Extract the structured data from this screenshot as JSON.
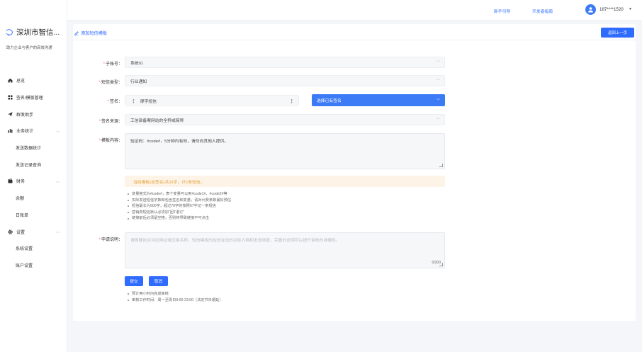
{
  "sidebar": {
    "brand_name": "深圳市智信...",
    "tagline": "助力企业与客户的高效沟通",
    "items": [
      {
        "label": "总览",
        "icon": "home-icon"
      },
      {
        "label": "签名/模板管理",
        "icon": "grid-icon"
      },
      {
        "label": "群发助手",
        "icon": "send-icon"
      },
      {
        "label": "业务统计",
        "icon": "bar-chart-icon",
        "expanded": true
      },
      {
        "label": "发送数据统计",
        "sub": true
      },
      {
        "label": "发送记录查询",
        "sub": true
      },
      {
        "label": "财务",
        "icon": "wallet-icon",
        "expanded": true
      },
      {
        "label": "余额",
        "sub": true
      },
      {
        "label": "日账单",
        "sub": true
      },
      {
        "label": "设置",
        "icon": "gear-icon",
        "expanded": true
      },
      {
        "label": "系统设置",
        "sub": true
      },
      {
        "label": "账户设置",
        "sub": true
      }
    ]
  },
  "header": {
    "guide_link": "新手引导",
    "dev_link": "开发者指南",
    "user_phone": "187****1520"
  },
  "page": {
    "title": "添加短信模板",
    "back_button": "返回上一页"
  },
  "form": {
    "sub_account": {
      "label": "子账号：",
      "value": "系统01"
    },
    "sms_type": {
      "label": "短信类型：",
      "value": "行业通知"
    },
    "signature": {
      "label": "签名：",
      "open_bracket": "【",
      "close_bracket": "】",
      "value": "摩字短信",
      "select_label": "选择已有签名"
    },
    "signature_source": {
      "label": "签名来源：",
      "value": "工信部备案网站的全称或简称"
    },
    "template_content": {
      "label": "模板内容：",
      "value": "验证码：#code#，5分钟内有效，请勿向其他人提供。"
    },
    "count_warning": "当前模板(含签名)共33字，计1条短信。",
    "content_notes": [
      "变量格式为#code#，表个变量可以用#code1#、#code2#等",
      "实际发送短信字数和包含签名和变量，请对计费条数最好预估",
      "短信最长为500字，超过70字的按照67字记一条短信",
      "营销类短信默认必须加“回T退订”",
      "链接前后必须留空格，否则将导致链接不可点击"
    ],
    "apply_desc": {
      "label": "申请说明：",
      "placeholder": "请简要告诉对应网址或应用名称、短信模板的短信发送的目标人群和发送场景，完善的说明可以提升审核的准确性。",
      "counter": "0/200"
    },
    "submit": "提交",
    "cancel": "取消",
    "footer_notes": [
      "预计两小时内完成审核",
      "审核工作时间：周一至周日9:00-23:00（法定节日顺延）"
    ]
  },
  "colors": {
    "accent": "#2f6bff",
    "warning_bg": "#fdf3e6",
    "warning_text": "#e6a23c",
    "required": "#f56c6c"
  }
}
